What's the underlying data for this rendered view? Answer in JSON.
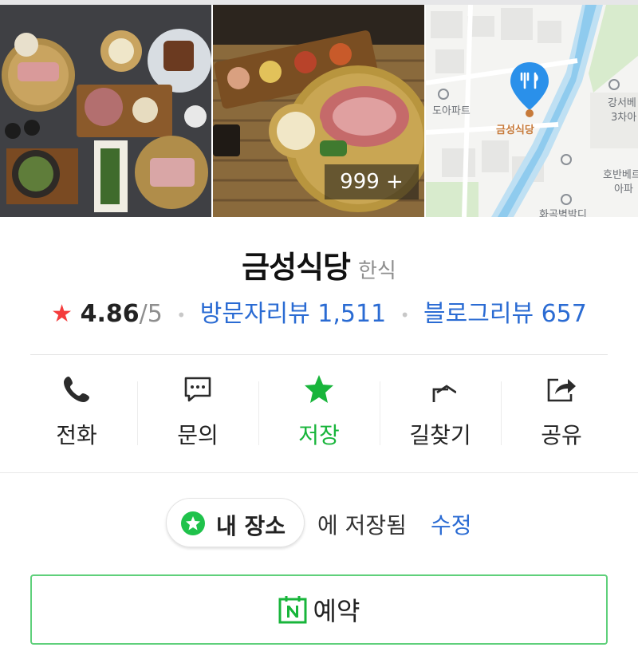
{
  "gallery": {
    "more_count": "999 +",
    "map_labels": {
      "apartment": "도아파트",
      "pin": "금성식당",
      "right_top": "강서베",
      "right_top2": "3차아",
      "right_mid": "호반베르",
      "right_mid2": "아파",
      "bottom": "화곡벽박디"
    }
  },
  "place": {
    "name": "금성식당",
    "category": "한식",
    "rating": "4.86",
    "rating_max": "/5",
    "visitor_reviews": "방문자리뷰 1,511",
    "blog_reviews": "블로그리뷰 657"
  },
  "actions": [
    {
      "label": "전화",
      "icon": "phone-icon"
    },
    {
      "label": "문의",
      "icon": "chat-icon"
    },
    {
      "label": "저장",
      "icon": "star-icon"
    },
    {
      "label": "길찾기",
      "icon": "directions-icon"
    },
    {
      "label": "공유",
      "icon": "share-icon"
    }
  ],
  "saved": {
    "list_name": "내 장소",
    "saved_text": "에 저장됨",
    "edit_label": "수정"
  },
  "reserve": {
    "label": "예약"
  },
  "colors": {
    "accent_green": "#18b53b",
    "link_blue": "#2a6bd3",
    "rating_star": "#f43c3c",
    "reserve_border": "#5fd07b"
  }
}
